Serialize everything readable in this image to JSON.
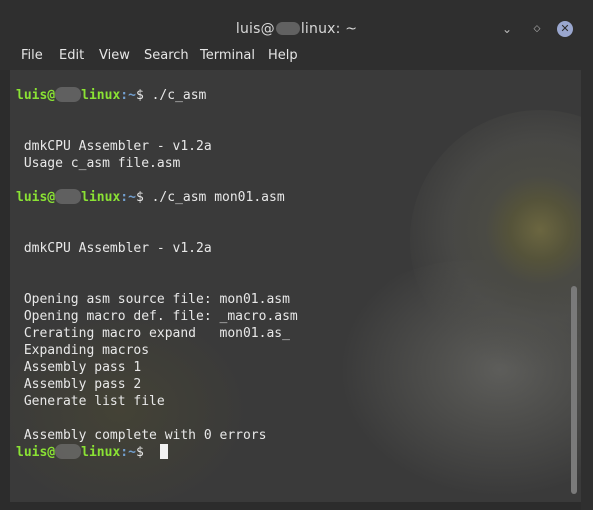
{
  "window": {
    "title_user": "luis@",
    "title_host_suffix": "linux: ~",
    "buttons": {
      "minimize": "⌄",
      "maximize": "◇",
      "close": "✕"
    }
  },
  "menu": [
    "File",
    "Edit",
    "View",
    "Search",
    "Terminal",
    "Help"
  ],
  "terminal": {
    "prompt_user": "luis@",
    "prompt_host_suffix": "linux",
    "prompt_path": ":~",
    "prompt_sign": "$",
    "lines": [
      {
        "type": "prompt",
        "cmd": " ./c_asm"
      },
      {
        "type": "text",
        "text": ""
      },
      {
        "type": "text",
        "text": ""
      },
      {
        "type": "text",
        "text": " dmkCPU Assembler - v1.2a"
      },
      {
        "type": "text",
        "text": " Usage c_asm file.asm"
      },
      {
        "type": "text",
        "text": ""
      },
      {
        "type": "prompt",
        "cmd": " ./c_asm mon01.asm"
      },
      {
        "type": "text",
        "text": ""
      },
      {
        "type": "text",
        "text": ""
      },
      {
        "type": "text",
        "text": " dmkCPU Assembler - v1.2a"
      },
      {
        "type": "text",
        "text": ""
      },
      {
        "type": "text",
        "text": ""
      },
      {
        "type": "text",
        "text": " Opening asm source file: mon01.asm"
      },
      {
        "type": "text",
        "text": " Opening macro def. file: _macro.asm"
      },
      {
        "type": "text",
        "text": " Crerating macro expand   mon01.as_"
      },
      {
        "type": "text",
        "text": " Expanding macros"
      },
      {
        "type": "text",
        "text": " Assembly pass 1"
      },
      {
        "type": "text",
        "text": " Assembly pass 2"
      },
      {
        "type": "text",
        "text": " Generate list file"
      },
      {
        "type": "text",
        "text": ""
      },
      {
        "type": "text",
        "text": " Assembly complete with 0 errors"
      },
      {
        "type": "prompt",
        "cmd": " ",
        "cursor": true
      }
    ]
  },
  "colors": {
    "prompt_user": "#8ae234",
    "prompt_path": "#729fcf",
    "text": "#e8e8e8",
    "background": "#3a3a3a"
  }
}
